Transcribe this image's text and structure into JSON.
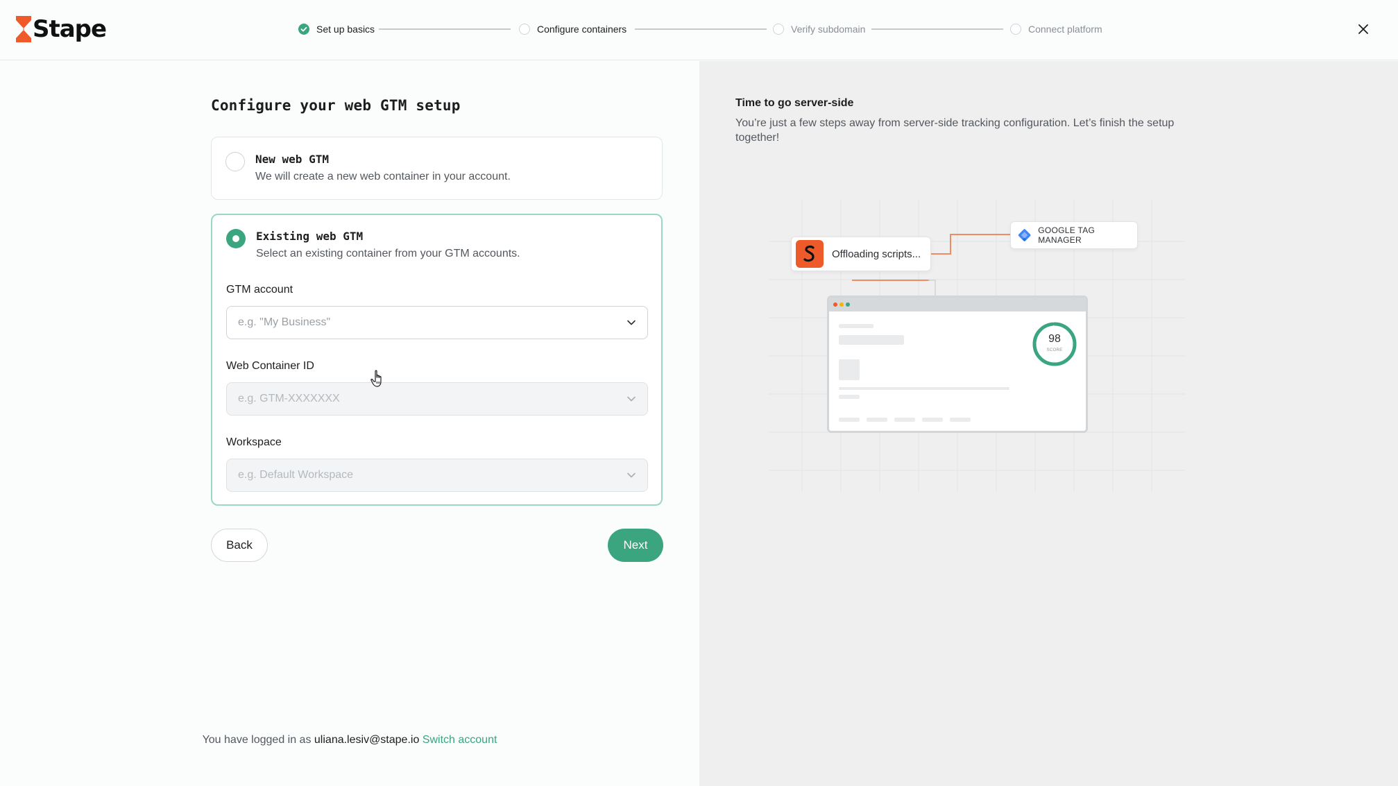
{
  "app": {
    "brand": "Stape",
    "accent": "#3aa57f",
    "brand_color": "#ee5a2a"
  },
  "stepper": {
    "steps": [
      {
        "label": "Set up basics",
        "state": "done"
      },
      {
        "label": "Configure containers",
        "state": "active"
      },
      {
        "label": "Verify subdomain",
        "state": "pending"
      },
      {
        "label": "Connect platform",
        "state": "pending"
      }
    ]
  },
  "main": {
    "title": "Configure your web GTM setup",
    "options": {
      "new": {
        "title": "New web GTM",
        "description": "We will create a new web container in your account.",
        "selected": false
      },
      "existing": {
        "title": "Existing web GTM",
        "description": "Select an existing container from your GTM accounts.",
        "selected": true
      }
    },
    "fields": {
      "gtm_account": {
        "label": "GTM account",
        "placeholder": "e.g. \"My Business\""
      },
      "container_id": {
        "label": "Web Container ID",
        "placeholder": "e.g. GTM-XXXXXXX"
      },
      "workspace": {
        "label": "Workspace",
        "placeholder": "e.g. Default Workspace"
      }
    },
    "buttons": {
      "back": "Back",
      "next": "Next"
    }
  },
  "footer": {
    "prefix": "You have logged in as",
    "email": "uliana.lesiv@stape.io",
    "switch_label": "Switch account"
  },
  "aside": {
    "title": "Time to go server-side",
    "description": "You’re just a few steps away from server-side tracking configuration. Let’s finish the setup together!",
    "illustration": {
      "stape_pill": "Offloading scripts...",
      "gtm_pill": "GOOGLE TAG MANAGER",
      "score_value": "98",
      "score_label": "SCORE"
    }
  }
}
